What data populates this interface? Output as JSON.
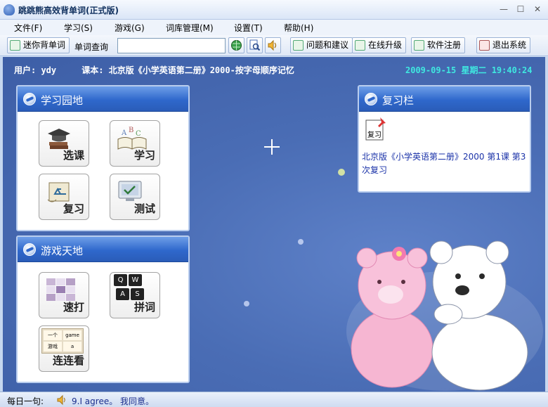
{
  "window": {
    "title": "跳跳熊高效背单词(正式版)",
    "minimize": "—",
    "maximize": "☐",
    "close": "✕"
  },
  "menu": [
    "文件(F)",
    "学习(S)",
    "游戏(G)",
    "词库管理(M)",
    "设置(T)",
    "帮助(H)"
  ],
  "toolbar": {
    "mini_label": "迷你背单词",
    "search_label": "单词查询",
    "search_value": "",
    "feedback_label": "问题和建议",
    "upgrade_label": "在线升级",
    "register_label": "软件注册",
    "exit_label": "退出系统"
  },
  "info": {
    "user_line": "用户: ydy",
    "course_line": "课本: 北京版《小学英语第二册》2000-按字母顺序记忆",
    "datetime": "2009-09-15 星期二 19:40:24"
  },
  "study_panel": {
    "title": "学习园地",
    "tiles": [
      {
        "label": "选课",
        "icon": "graduation-cap-icon"
      },
      {
        "label": "学习",
        "icon": "open-book-icon"
      },
      {
        "label": "复习",
        "icon": "recycle-scroll-icon"
      },
      {
        "label": "测试",
        "icon": "monitor-icon"
      }
    ]
  },
  "game_panel": {
    "title": "游戏天地",
    "tiles": [
      {
        "label": "速打",
        "icon": "grid-icon"
      },
      {
        "label": "拼词",
        "icon": "keyboard-keys-icon",
        "keys": [
          "Q",
          "W",
          "A",
          "S"
        ]
      },
      {
        "label": "连连看",
        "icon": "match-cards-icon",
        "cards": [
          "一个",
          "game",
          "游戏",
          "a"
        ]
      }
    ]
  },
  "review_panel": {
    "title": "复习栏",
    "note_label": "复习",
    "item": "北京版《小学英语第二册》2000 第1课 第3次复习"
  },
  "status": {
    "label": "每日一句:",
    "sentence": "9.I agree。  我同意。"
  },
  "colors": {
    "accent": "#2f68cc",
    "background": "#4a6db5",
    "clock": "#3fe8e0"
  }
}
